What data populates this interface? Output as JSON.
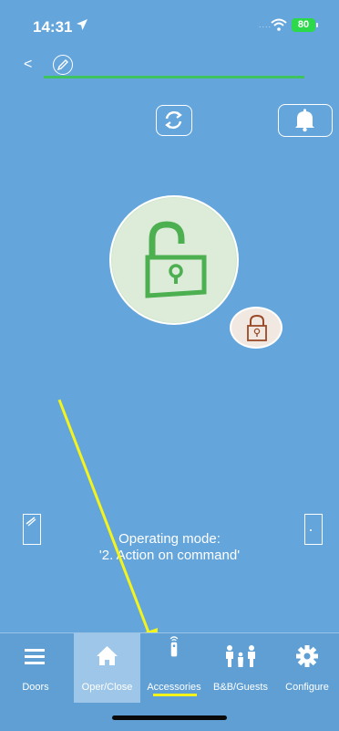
{
  "status_bar": {
    "time": "14:31",
    "battery": "80"
  },
  "header": {
    "back_label": "<"
  },
  "mode": {
    "line1": "Operating mode:",
    "line2": "'2. Action on command'"
  },
  "tabs": [
    {
      "label": "Doors",
      "icon": "menu-icon"
    },
    {
      "label": "Oper/Close",
      "icon": "home-icon",
      "active": true
    },
    {
      "label": "Accessories",
      "icon": "remote-icon"
    },
    {
      "label": "B&B/Guests",
      "icon": "family-icon"
    },
    {
      "label": "Configure",
      "icon": "gear-icon"
    }
  ],
  "colors": {
    "background": "#64a5dc",
    "lock_green": "#4caf50",
    "lock_brown": "#9a4a28",
    "highlight_yellow": "#f4f41a",
    "underline_green": "#3ec35e"
  }
}
